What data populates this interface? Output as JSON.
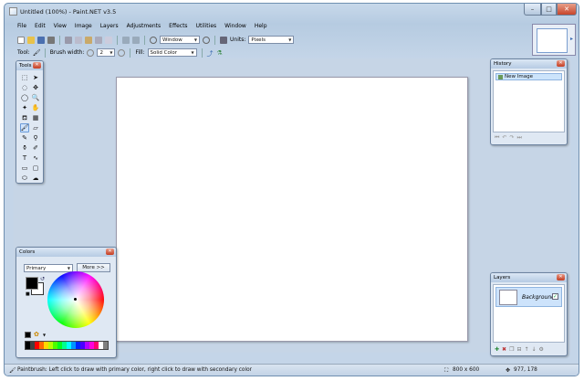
{
  "window": {
    "title": "Untitled (100%) - Paint.NET v3.5"
  },
  "menu": [
    "File",
    "Edit",
    "View",
    "Image",
    "Layers",
    "Adjustments",
    "Effects",
    "Utilities",
    "Window",
    "Help"
  ],
  "toolbar": {
    "zoom_value": "Window",
    "units_label": "Units:",
    "units_value": "Pixels",
    "tool_label": "Tool:",
    "brush_width_label": "Brush width:",
    "brush_width_value": "2",
    "fill_label": "Fill:",
    "fill_value": "Solid Color"
  },
  "tools_panel": {
    "title": "Tools",
    "icons": [
      "rectangle-select-icon",
      "move-selection-icon",
      "lasso-select-icon",
      "move-selected-icon",
      "ellipse-select-icon",
      "zoom-icon",
      "magic-wand-icon",
      "pan-icon",
      "paint-bucket-icon",
      "gradient-icon",
      "paintbrush-icon",
      "eraser-icon",
      "pencil-icon",
      "color-picker-icon",
      "clone-stamp-icon",
      "recolor-icon",
      "text-icon",
      "line-curve-icon",
      "rectangle-icon",
      "rounded-rectangle-icon",
      "ellipse-icon",
      "freeform-shape-icon"
    ],
    "active_index": 10
  },
  "colors_panel": {
    "title": "Colors",
    "mode_value": "Primary",
    "more_label": "More >>",
    "primary_color": "#000000",
    "secondary_color": "#ffffff"
  },
  "history_panel": {
    "title": "History",
    "items": [
      "New Image"
    ]
  },
  "layers_panel": {
    "title": "Layers",
    "items": [
      {
        "name": "Background",
        "visible": true
      }
    ]
  },
  "status": {
    "message": "Paintbrush: Left click to draw with primary color, right click to draw with secondary color",
    "image_size": "800 x 600",
    "cursor_position": "977, 178"
  },
  "palette_colors": [
    "#000000",
    "#404040",
    "#ff0000",
    "#ff6a00",
    "#ffd800",
    "#b6ff00",
    "#4cff00",
    "#00ff21",
    "#00ff90",
    "#00ffff",
    "#0094ff",
    "#0026ff",
    "#4800ff",
    "#b200ff",
    "#ff00dc",
    "#ff006e",
    "#ffffff",
    "#808080"
  ]
}
